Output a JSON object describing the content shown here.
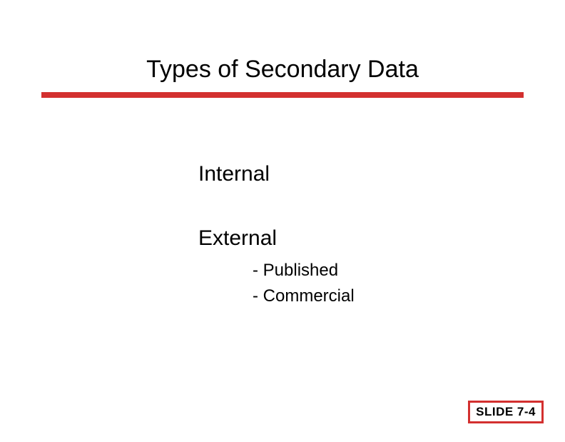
{
  "title": "Types of Secondary Data",
  "items": {
    "internal": "Internal",
    "external": "External",
    "sub1": "- Published",
    "sub2": "- Commercial"
  },
  "slide_label": "SLIDE 7-4"
}
